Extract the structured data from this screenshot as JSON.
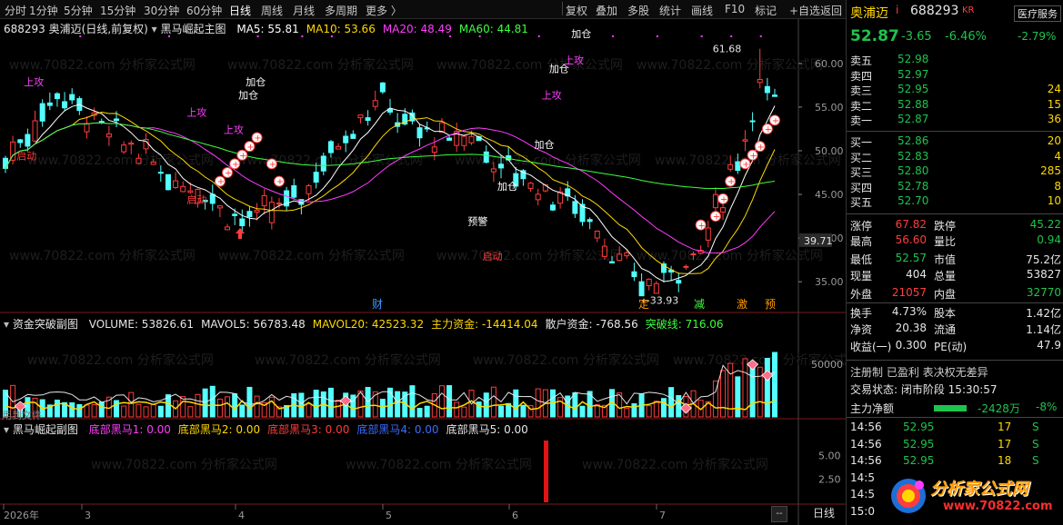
{
  "toolbar": {
    "periods": [
      "分时",
      "1分钟",
      "5分钟",
      "15分钟",
      "30分钟",
      "60分钟",
      "日线",
      "周线",
      "月线",
      "多周期",
      "更多 〉"
    ],
    "active_period": "日线",
    "actions": [
      "复权",
      "叠加",
      "多股",
      "统计",
      "画线",
      "F10",
      "标记",
      "+自选",
      "返回"
    ]
  },
  "main_chart": {
    "header_code": "688293",
    "header_name": "奥浦迈(日线,前复权)",
    "formula": "黑马崛起主图",
    "ma": [
      {
        "label": "MA5: 55.81",
        "color": "#ffffff"
      },
      {
        "label": "MA10: 53.66",
        "color": "#ffd800"
      },
      {
        "label": "MA20: 48.49",
        "color": "#ff3dff"
      },
      {
        "label": "MA60: 44.81",
        "color": "#3dff3d"
      }
    ],
    "price_ticks": [
      "60.00",
      "55.00",
      "50.00",
      "45.00",
      "40.00",
      "35.00"
    ],
    "current_price_tag": "39.71",
    "high_label": "61.68",
    "low_label": "33.93",
    "signals": [
      "上攻",
      "启动",
      "加仓",
      "上攻",
      "加仓",
      "启动",
      "上攻",
      "预警",
      "启动",
      "加仓",
      "加仓",
      "上攻",
      "加仓",
      "上攻",
      "加仓"
    ],
    "bottom_flags": [
      "财",
      "定",
      "减",
      "激",
      "预"
    ]
  },
  "chart_data": [
    {
      "type": "line",
      "title": "黑马崛起主图",
      "series": [
        {
          "name": "MA5",
          "values": [
            55.81
          ]
        },
        {
          "name": "MA10",
          "values": [
            53.66
          ]
        },
        {
          "name": "MA20",
          "values": [
            48.49
          ]
        },
        {
          "name": "MA60",
          "values": [
            44.81
          ]
        }
      ],
      "ylim": [
        32,
        63
      ],
      "annotations": [
        "61.68",
        "33.93"
      ]
    },
    {
      "type": "bar",
      "title": "资金突破副图",
      "series": [
        {
          "name": "VOLUME",
          "values": [
            53826.61
          ]
        },
        {
          "name": "MAVOL5",
          "values": [
            56783.48
          ]
        },
        {
          "name": "MAVOL20",
          "values": [
            42523.32
          ]
        },
        {
          "name": "主力资金",
          "values": [
            -14414.04
          ]
        },
        {
          "name": "散户资金",
          "values": [
            -768.56
          ]
        },
        {
          "name": "突破线",
          "values": [
            716.06
          ]
        }
      ]
    },
    {
      "type": "bar",
      "title": "黑马崛起副图",
      "series": [
        {
          "name": "底部黑马1",
          "values": [
            0
          ]
        },
        {
          "name": "底部黑马2",
          "values": [
            0
          ]
        },
        {
          "name": "底部黑马3",
          "values": [
            0
          ]
        },
        {
          "name": "底部黑马4",
          "values": [
            0
          ]
        },
        {
          "name": "底部黑马5",
          "values": [
            0
          ]
        }
      ],
      "ylim": [
        0,
        7
      ]
    }
  ],
  "sub1": {
    "title": "资金突破副图",
    "items": [
      {
        "label": "VOLUME: 53826.61",
        "color": "#e6e6e6"
      },
      {
        "label": "MAVOL5: 56783.48",
        "color": "#e6e6e6"
      },
      {
        "label": "MAVOL20: 42523.32",
        "color": "#ffd800"
      },
      {
        "label": "主力资金: -14414.04",
        "color": "#ffd800"
      },
      {
        "label": "散户资金: -768.56",
        "color": "#e6e6e6"
      },
      {
        "label": "突破线: 716.06",
        "color": "#3dff3d"
      }
    ],
    "tick": "50000",
    "corner_text": "用到文件"
  },
  "sub2": {
    "title": "黑马崛起副图",
    "items": [
      {
        "label": "底部黑马1: 0.00",
        "color": "#ff3dff"
      },
      {
        "label": "底部黑马2: 0.00",
        "color": "#ffd800"
      },
      {
        "label": "底部黑马3: 0.00",
        "color": "#ff3d3d"
      },
      {
        "label": "底部黑马4: 0.00",
        "color": "#3d6bff"
      },
      {
        "label": "底部黑马5: 0.00",
        "color": "#e6e6e6"
      }
    ],
    "ticks": [
      "5.00",
      "2.50"
    ]
  },
  "time_axis": {
    "labels": [
      "2026年",
      "3",
      "4",
      "5",
      "6",
      "7"
    ],
    "period_button": "日线",
    "minus_button": "--"
  },
  "watermark": "www.70822.com 分析家公式网",
  "quote": {
    "name": "奥浦迈",
    "code": "688293",
    "badge": "KR",
    "sector": "医疗服务",
    "sector_change": "-2.79%",
    "price": "52.87",
    "change": "-3.65",
    "change_pct": "-6.46%",
    "asks": [
      {
        "label": "卖五",
        "price": "52.98",
        "vol": ""
      },
      {
        "label": "卖四",
        "price": "52.97",
        "vol": ""
      },
      {
        "label": "卖三",
        "price": "52.95",
        "vol": "24"
      },
      {
        "label": "卖二",
        "price": "52.88",
        "vol": "15"
      },
      {
        "label": "卖一",
        "price": "52.87",
        "vol": "36"
      }
    ],
    "bids": [
      {
        "label": "买一",
        "price": "52.86",
        "vol": "20"
      },
      {
        "label": "买二",
        "price": "52.83",
        "vol": "4"
      },
      {
        "label": "买三",
        "price": "52.80",
        "vol": "285"
      },
      {
        "label": "买四",
        "price": "52.78",
        "vol": "8"
      },
      {
        "label": "买五",
        "price": "52.70",
        "vol": "10"
      }
    ],
    "stats": [
      {
        "l1": "涨停",
        "v1": "67.82",
        "c1": "#ff3d3d",
        "l2": "跌停",
        "v2": "45.22",
        "c2": "#1ec44c"
      },
      {
        "l1": "最高",
        "v1": "56.60",
        "c1": "#ff3d3d",
        "l2": "量比",
        "v2": "0.94",
        "c2": "#1ec44c"
      },
      {
        "l1": "最低",
        "v1": "52.57",
        "c1": "#1ec44c",
        "l2": "市值",
        "v2": "75.2亿",
        "c2": "#e6e6e6"
      },
      {
        "l1": "现量",
        "v1": "404",
        "c1": "#e6e6e6",
        "l2": "总量",
        "v2": "53827",
        "c2": "#e6e6e6"
      },
      {
        "l1": "外盘",
        "v1": "21057",
        "c1": "#ff3d3d",
        "l2": "内盘",
        "v2": "32770",
        "c2": "#1ec44c"
      },
      {
        "l1": "换手",
        "v1": "4.73%",
        "c1": "#e6e6e6",
        "l2": "股本",
        "v2": "1.42亿",
        "c2": "#e6e6e6"
      },
      {
        "l1": "净资",
        "v1": "20.38",
        "c1": "#e6e6e6",
        "l2": "流通",
        "v2": "1.14亿",
        "c2": "#e6e6e6"
      },
      {
        "l1": "收益(一)",
        "v1": "0.300",
        "c1": "#e6e6e6",
        "l2": "PE(动)",
        "v2": "47.9",
        "c2": "#e6e6e6"
      }
    ],
    "tags": "注册制  已盈利  表决权无差异",
    "trade_status": "交易状态: 闭市阶段 15:30:57",
    "main_flow_label": "主力净额",
    "main_flow_value": "-2428万",
    "main_flow_pct": "-8%",
    "ticks": [
      {
        "time": "14:56",
        "price": "52.95",
        "vol": "17",
        "bs": "S"
      },
      {
        "time": "14:56",
        "price": "52.95",
        "vol": "17",
        "bs": "S"
      },
      {
        "time": "14:56",
        "price": "52.95",
        "vol": "18",
        "bs": "S"
      },
      {
        "time": "14:5",
        "price": "",
        "vol": "",
        "bs": ""
      },
      {
        "time": "14:5",
        "price": "",
        "vol": "",
        "bs": ""
      },
      {
        "time": "15:0",
        "price": "",
        "vol": "",
        "bs": ""
      }
    ],
    "logo_text": "分析家公式网",
    "logo_url": "www.70822.com"
  }
}
